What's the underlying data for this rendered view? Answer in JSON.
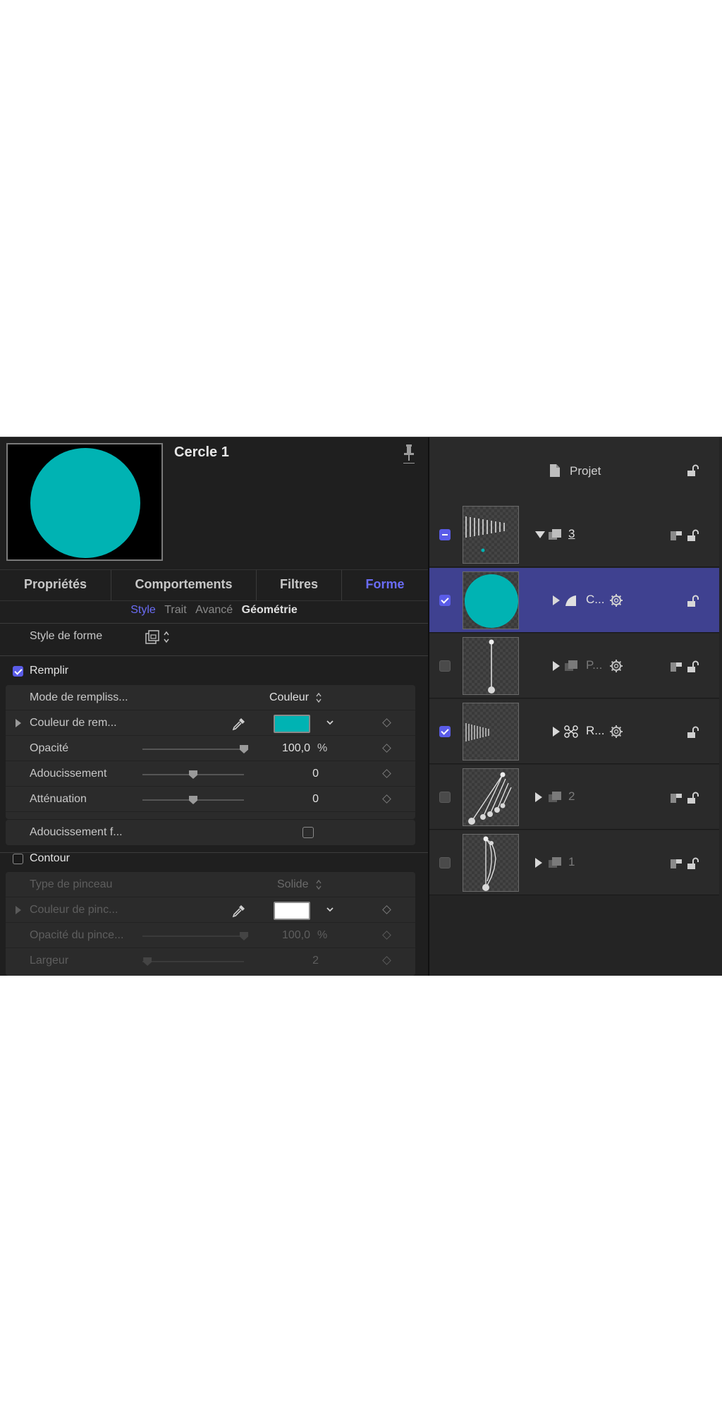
{
  "inspector": {
    "object_title": "Cercle 1",
    "preview_color": "#00b3b3",
    "tabs": [
      {
        "label": "Propriétés"
      },
      {
        "label": "Comportements"
      },
      {
        "label": "Filtres"
      },
      {
        "label": "Forme"
      }
    ],
    "active_tab": "Forme",
    "subtabs": [
      {
        "label": "Style"
      },
      {
        "label": "Trait"
      },
      {
        "label": "Avancé"
      },
      {
        "label": "Géométrie"
      }
    ],
    "active_subtab": "Style",
    "shape_style_label": "Style de forme",
    "fill": {
      "enabled": true,
      "section_label": "Remplir",
      "mode_label": "Mode de rempliss...",
      "mode_value": "Couleur",
      "color_label": "Couleur de rem...",
      "color_value": "#00b3b3",
      "opacity_label": "Opacité",
      "opacity_value": "100,0",
      "opacity_unit": "%",
      "opacity_level": 1.0,
      "softness_label": "Adoucissement",
      "softness_value": "0",
      "softness_level": 0.5,
      "falloff_label": "Atténuation",
      "falloff_value": "0",
      "falloff_level": 0.5,
      "edge_soft_label": "Adoucissement f...",
      "edge_soft_checked": false
    },
    "outline": {
      "enabled": false,
      "section_label": "Contour",
      "brush_type_label": "Type de pinceau",
      "brush_type_value": "Solide",
      "brush_color_label": "Couleur de pinc...",
      "brush_color_value": "#ffffff",
      "brush_opacity_label": "Opacité du pince...",
      "brush_opacity_value": "100,0",
      "brush_opacity_unit": "%",
      "brush_opacity_level": 1.0,
      "width_label": "Largeur",
      "width_value": "2",
      "width_level": 0.05
    }
  },
  "layers": {
    "project_label": "Projet",
    "rows": [
      {
        "name": "3",
        "state": "mixed",
        "expanded": true,
        "selected": false,
        "dim": false
      },
      {
        "name": "C...",
        "state": "checked",
        "expanded": false,
        "selected": true,
        "dim": false
      },
      {
        "name": "P...",
        "state": "unchecked",
        "expanded": false,
        "selected": false,
        "dim": true
      },
      {
        "name": "R...",
        "state": "checked",
        "expanded": false,
        "selected": false,
        "dim": false
      },
      {
        "name": "2",
        "state": "unchecked",
        "expanded": false,
        "selected": false,
        "dim": true
      },
      {
        "name": "1",
        "state": "unchecked",
        "expanded": false,
        "selected": false,
        "dim": true
      }
    ]
  }
}
